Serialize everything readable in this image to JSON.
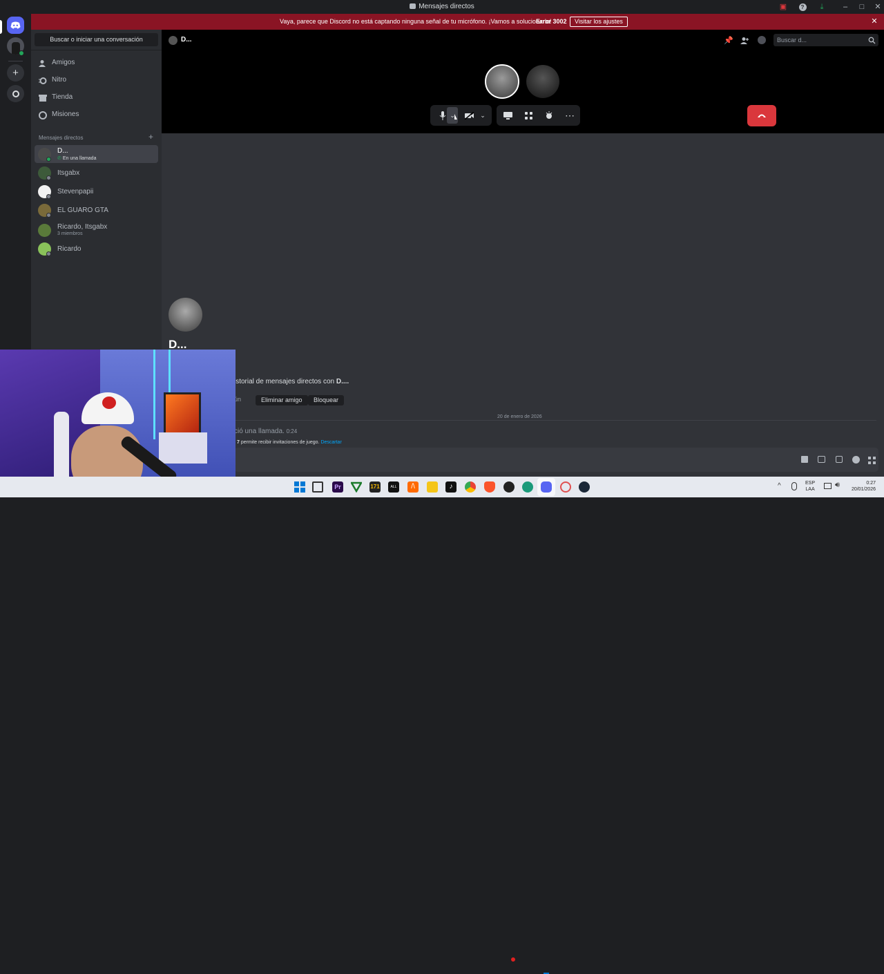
{
  "window": {
    "title": "Mensajes directos"
  },
  "banner": {
    "message": "Vaya, parece que Discord no está captando ninguna señal de tu micrófono. ¡Vamos a solucionarlo!",
    "error": "Error 3002",
    "button": "Visitar los ajustes"
  },
  "sidebar": {
    "search": "Buscar o iniciar una conversación",
    "nav": [
      {
        "label": "Amigos",
        "icon": "friends-icon"
      },
      {
        "label": "Nitro",
        "icon": "nitro-icon"
      },
      {
        "label": "Tienda",
        "icon": "shop-icon"
      },
      {
        "label": "Misiones",
        "icon": "quests-icon"
      }
    ],
    "dm_header": "Mensajes directos",
    "dms": [
      {
        "name": "D...",
        "sub": "En una llamada"
      },
      {
        "name": "Itsgabx",
        "sub": ""
      },
      {
        "name": "Stevenpapii",
        "sub": ""
      },
      {
        "name": "EL GUARO GTA",
        "sub": ""
      },
      {
        "name": "Ricardo, Itsgabx",
        "sub": "3 miembros"
      },
      {
        "name": "Ricardo",
        "sub": ""
      }
    ]
  },
  "header": {
    "title": "D...",
    "search_placeholder": "Buscar d..."
  },
  "profile": {
    "name": "D...",
    "history_text": "istorial de mensajes directos con",
    "history_name": "D....",
    "partial_button": "ún",
    "remove_friend": "Eliminar amigo",
    "block": "Bloquear"
  },
  "chat": {
    "date_divider": "20 de enero de 2026",
    "call_text": "ció una llamada.",
    "call_time": "0:24",
    "invite_num": "7",
    "invite_text": "permite recibir invitaciones de juego.",
    "invite_link": "Descartar"
  },
  "taskbar": {
    "lang": "ESP",
    "region": "LAA",
    "time": "0:27",
    "date": "20/01/2026"
  },
  "colors": {
    "banner": "#8a1424",
    "hangup": "#da373c",
    "blurple": "#5865f2",
    "link": "#00a8fc"
  }
}
